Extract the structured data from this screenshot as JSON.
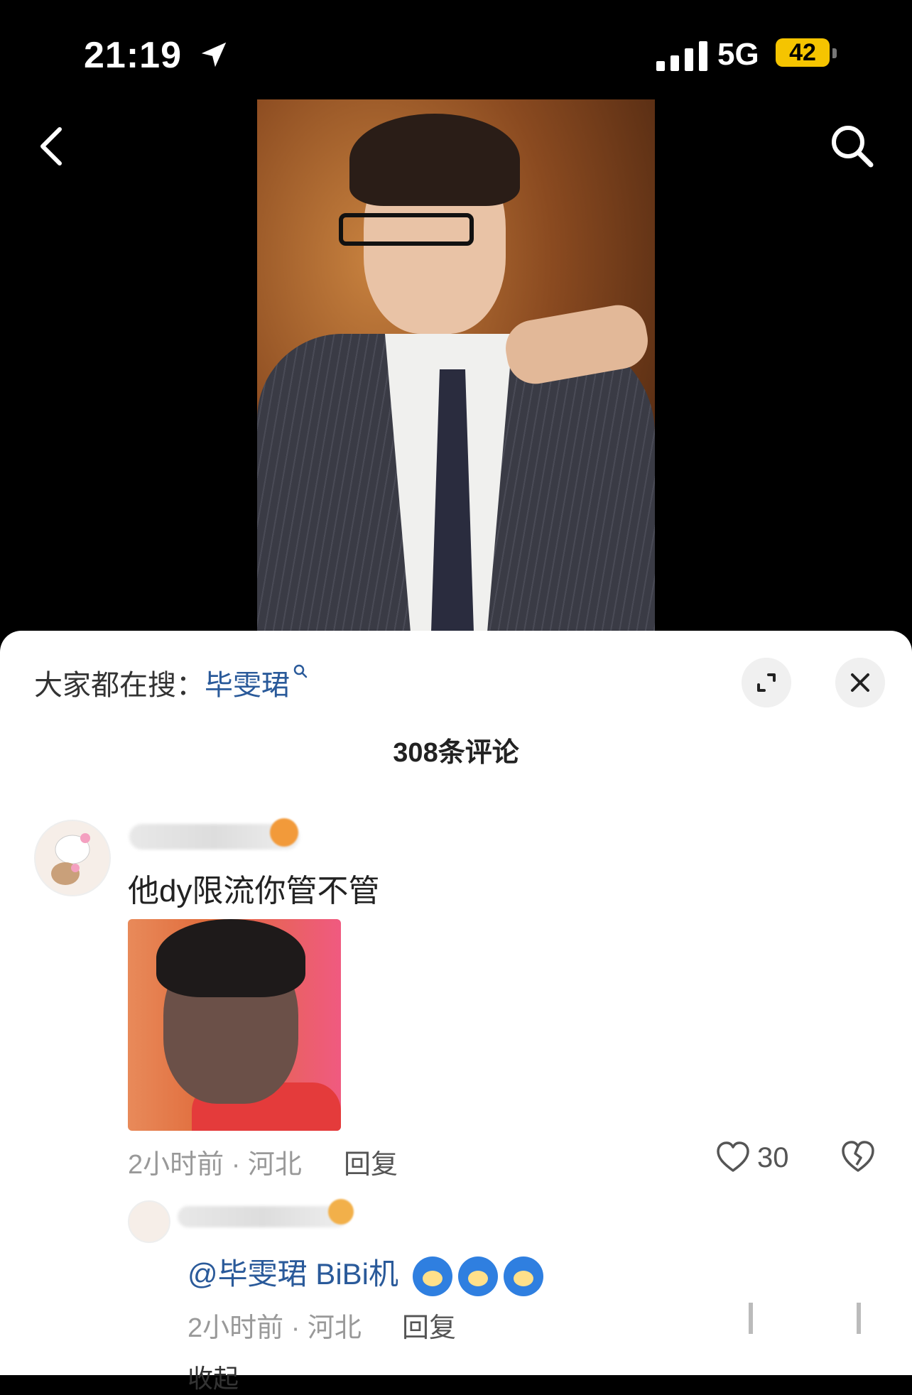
{
  "status_bar": {
    "time": "21:19",
    "network": "5G",
    "battery": "42"
  },
  "search_suggest": {
    "prefix": "大家都在搜：",
    "keyword": "毕雯珺"
  },
  "comments_header": {
    "count_label": "308条评论"
  },
  "comment": {
    "text": "他dy限流你管不管",
    "meta": "2小时前 · 河北",
    "reply_label": "回复",
    "likes": "30"
  },
  "reply": {
    "text": "@毕雯珺 BiBi机",
    "meta": "2小时前 · 河北",
    "reply_label": "回复"
  },
  "collapse_label": "收起"
}
